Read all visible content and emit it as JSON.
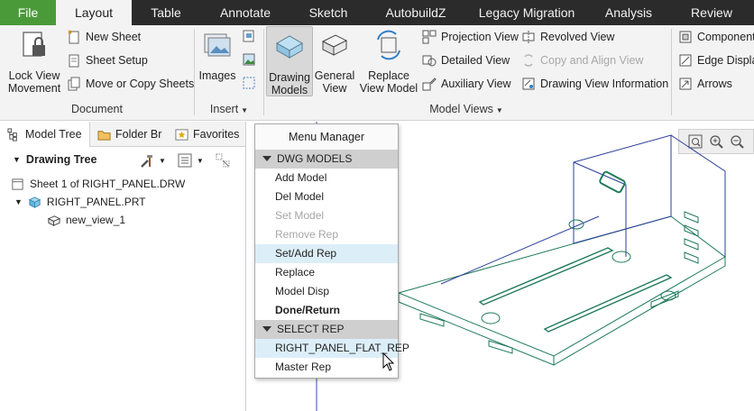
{
  "tabs": [
    {
      "label": "File"
    },
    {
      "label": "Layout"
    },
    {
      "label": "Table"
    },
    {
      "label": "Annotate"
    },
    {
      "label": "Sketch"
    },
    {
      "label": "AutobuildZ"
    },
    {
      "label": "Legacy Migration"
    },
    {
      "label": "Analysis"
    },
    {
      "label": "Review"
    }
  ],
  "active_tab": "Layout",
  "ribbon": {
    "document": {
      "label": "Document",
      "lock_view": "Lock View",
      "lock_view2": "Movement",
      "new_sheet": "New Sheet",
      "sheet_setup": "Sheet Setup",
      "move_copy": "Move or Copy Sheets"
    },
    "insert": {
      "label": "Insert",
      "images": "Images"
    },
    "model_views": {
      "label": "Model Views",
      "drawing_models_1": "Drawing",
      "drawing_models_2": "Models",
      "general_view_1": "General",
      "general_view_2": "View",
      "replace_view_1": "Replace",
      "replace_view_2": "View Model",
      "projection": "Projection View",
      "detailed": "Detailed View",
      "auxiliary": "Auxiliary View",
      "revolved": "Revolved View",
      "copy_align": "Copy and Align View",
      "drawing_view_info": "Drawing View Information"
    },
    "right": {
      "component": "Component",
      "edge_display": "Edge Display",
      "arrows": "Arrows"
    }
  },
  "left_panel": {
    "tabs": [
      "Model Tree",
      "Folder Br",
      "Favorites"
    ],
    "tree_title": "Drawing Tree",
    "rows": [
      {
        "label": "Sheet 1 of RIGHT_PANEL.DRW"
      },
      {
        "label": "RIGHT_PANEL.PRT"
      },
      {
        "label": "new_view_1"
      }
    ]
  },
  "menu_manager": {
    "title": "Menu Manager",
    "section1": "DWG MODELS",
    "items1": [
      {
        "label": "Add Model",
        "state": "normal"
      },
      {
        "label": "Del Model",
        "state": "normal"
      },
      {
        "label": "Set Model",
        "state": "disabled"
      },
      {
        "label": "Remove Rep",
        "state": "disabled"
      },
      {
        "label": "Set/Add Rep",
        "state": "highlight"
      },
      {
        "label": "Replace",
        "state": "normal"
      },
      {
        "label": "Model Disp",
        "state": "normal"
      },
      {
        "label": "Done/Return",
        "state": "bold"
      }
    ],
    "section2": "SELECT REP",
    "items2": [
      {
        "label": "RIGHT_PANEL_FLAT_REP",
        "state": "highlight"
      },
      {
        "label": "Master Rep",
        "state": "normal"
      }
    ]
  },
  "colors": {
    "file_tab": "#4b9a3a",
    "tab_bar": "#2b2b2b",
    "ribbon": "#f3f3f3",
    "model_edge": "#1f7a5a",
    "model_edge_blue": "#2a3f9a",
    "menu_highlight": "#dceef8"
  }
}
